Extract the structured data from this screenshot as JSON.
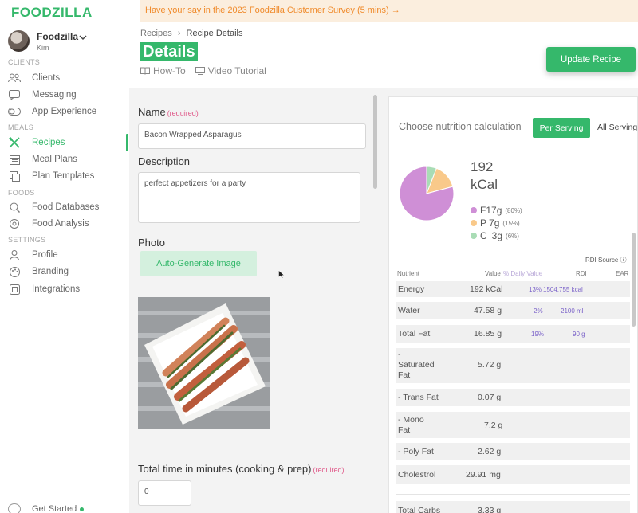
{
  "app": {
    "logo": "FOODZILLA",
    "user": {
      "name": "Foodzilla",
      "sub": "Kim"
    }
  },
  "sidebar": {
    "sections": [
      {
        "label": "CLIENTS",
        "items": [
          {
            "label": "Clients",
            "icon": "clients-icon"
          },
          {
            "label": "Messaging",
            "icon": "message-icon"
          },
          {
            "label": "App Experience",
            "icon": "toggle-icon"
          }
        ]
      },
      {
        "label": "MEALS",
        "items": [
          {
            "label": "Recipes",
            "icon": "utensils-icon"
          },
          {
            "label": "Meal Plans",
            "icon": "calendar-icon"
          },
          {
            "label": "Plan Templates",
            "icon": "copy-icon"
          }
        ]
      },
      {
        "label": "FOODS",
        "items": [
          {
            "label": "Food Databases",
            "icon": "search-icon"
          },
          {
            "label": "Food Analysis",
            "icon": "analysis-icon"
          }
        ]
      },
      {
        "label": "SETTINGS",
        "items": [
          {
            "label": "Profile",
            "icon": "user-icon"
          },
          {
            "label": "Branding",
            "icon": "palette-icon"
          },
          {
            "label": "Integrations",
            "icon": "integrations-icon"
          }
        ]
      }
    ],
    "active": "Recipes",
    "get_started": "Get Started"
  },
  "banner": {
    "text": "Have your say in the 2023 Foodzilla Customer Survey (5 mins) →"
  },
  "breadcrumb": {
    "parent": "Recipes",
    "sep": "›",
    "current": "Recipe Details"
  },
  "page": {
    "title": "Details",
    "tabs": [
      {
        "label": "How-To",
        "icon": "book-icon"
      },
      {
        "label": "Video Tutorial",
        "icon": "monitor-icon"
      }
    ],
    "update_button": "Update Recipe"
  },
  "form": {
    "name_label": "Name",
    "required": "(required)",
    "name_value": "Bacon Wrapped Asparagus",
    "description_label": "Description",
    "description_value": "perfect appetizers for a party",
    "photo_label": "Photo",
    "auto_generate": "Auto-Generate Image",
    "time_label": "Total time in minutes (cooking & prep)",
    "time_value": "0"
  },
  "nutrition": {
    "heading": "Choose nutrition calculation",
    "per_serving": "Per Serving",
    "all_servings": "All Servings",
    "kcal": "192",
    "kcal_unit": "kCal",
    "colors": {
      "fat": "#cf8fd6",
      "protein": "#f9c98a",
      "carbs": "#a9dcb5"
    },
    "macros": [
      {
        "letter": "F",
        "value": "17g",
        "pct": "(80%)",
        "color": "#cf8fd6"
      },
      {
        "letter": "P",
        "value": "7g",
        "pct": "(15%)",
        "color": "#f9c98a"
      },
      {
        "letter": "C",
        "value": "3g",
        "pct": "(6%)",
        "color": "#a9dcb5"
      }
    ],
    "pie_pct": {
      "fat": 80,
      "protein": 15,
      "carbs": 6
    },
    "rdi_source": "RDI Source ⓘ",
    "columns": {
      "nutrient": "Nutrient",
      "value": "Value",
      "daily": "% Daily Value",
      "rdi": "RDI",
      "ear": "EAR"
    },
    "rows": [
      {
        "name": "Energy",
        "value": "192 kCal",
        "daily": "13%",
        "rdi": "1504.755 kcal"
      },
      {
        "name": "Water",
        "value": "47.58 g",
        "daily": "2%",
        "rdi": "2100 ml"
      },
      {
        "name": "Total Fat",
        "value": "16.85 g",
        "daily": "19%",
        "rdi": "90 g"
      },
      {
        "name": "- Saturated Fat",
        "name_lines": [
          "-",
          "Saturated",
          "Fat"
        ],
        "value": "5.72 g",
        "daily": "",
        "rdi": ""
      },
      {
        "name": "- Trans Fat",
        "value": "0.07 g",
        "daily": "",
        "rdi": ""
      },
      {
        "name": "- Mono Fat",
        "name_lines": [
          "- Mono",
          "Fat"
        ],
        "value": "7.2 g",
        "daily": "",
        "rdi": ""
      },
      {
        "name": "- Poly Fat",
        "value": "2.62 g",
        "daily": "",
        "rdi": ""
      },
      {
        "name": "Cholestrol",
        "value": "29.91 mg",
        "daily": "",
        "rdi": ""
      },
      {
        "name": "Total Carbs",
        "value": "3.33 g",
        "daily": "",
        "rdi": ""
      }
    ]
  }
}
